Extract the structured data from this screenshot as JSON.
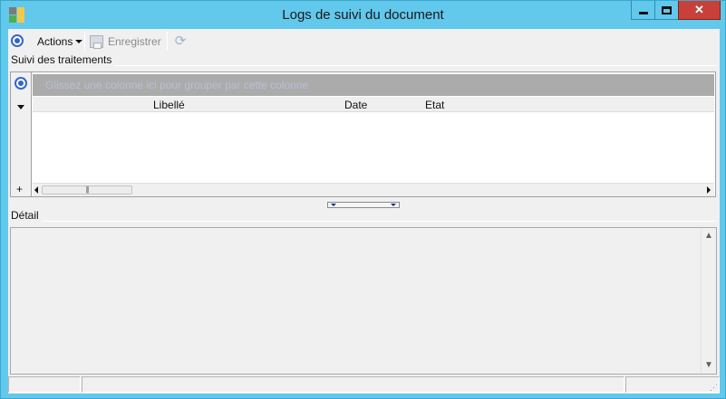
{
  "window": {
    "title": "Logs de suivi du document"
  },
  "toolbar": {
    "actions_label": "Actions",
    "save_label": "Enregistrer"
  },
  "tracking": {
    "section_title": "Suivi des traitements",
    "group_panel_text": "Glissez une colonne ici pour grouper par cette colonne",
    "columns": [
      "Libellé",
      "Date",
      "Etat"
    ],
    "rows": []
  },
  "detail": {
    "section_title": "Détail",
    "text": ""
  },
  "icons": {
    "app": "app-icon",
    "actions": "radio-target-icon",
    "save": "save-icon",
    "refresh": "refresh-icon"
  },
  "colors": {
    "title_bar": "#62c8ec",
    "close_button": "#c7403a",
    "accent": "#3366cc",
    "group_panel": "#ababab"
  }
}
